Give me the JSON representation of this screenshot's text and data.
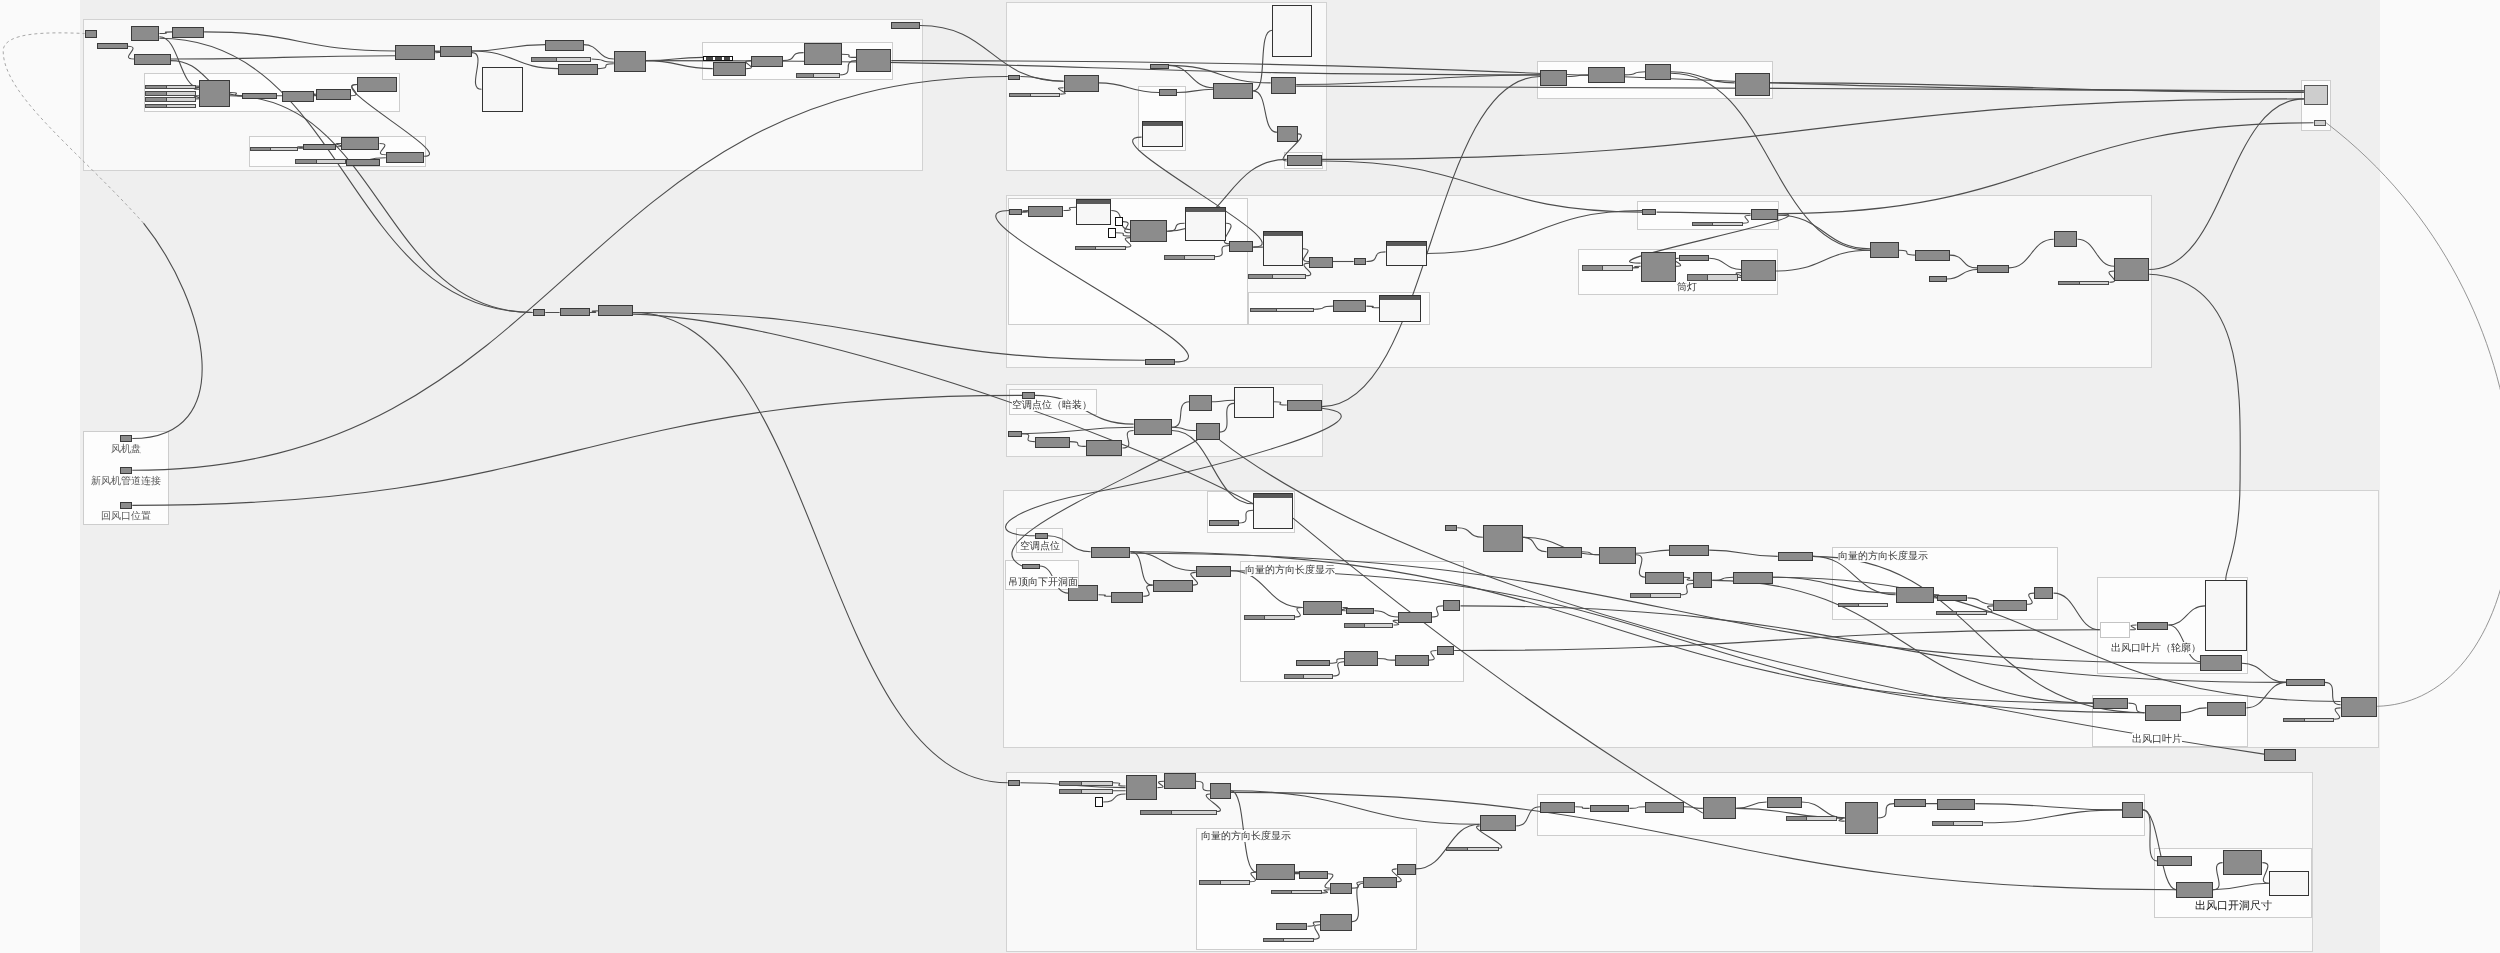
{
  "canvas": {
    "left_panel": {
      "parameters": [
        {
          "label": "风机盘"
        },
        {
          "label": "新风机管道连接"
        },
        {
          "label": "回风口位置"
        }
      ]
    },
    "groups": [
      {
        "label": "筒灯"
      },
      {
        "label": "空调点位（暗装）"
      },
      {
        "label": "空调点位"
      },
      {
        "label": "向量的方向长度显示"
      },
      {
        "label": "向量的方向长度显示"
      },
      {
        "label": "吊顶向下开洞面"
      },
      {
        "label": "出风口叶片（轮廓）"
      },
      {
        "label": "出风口叶片"
      },
      {
        "label": "向量的方向长度显示"
      },
      {
        "label": "出风口开洞尺寸"
      }
    ]
  }
}
